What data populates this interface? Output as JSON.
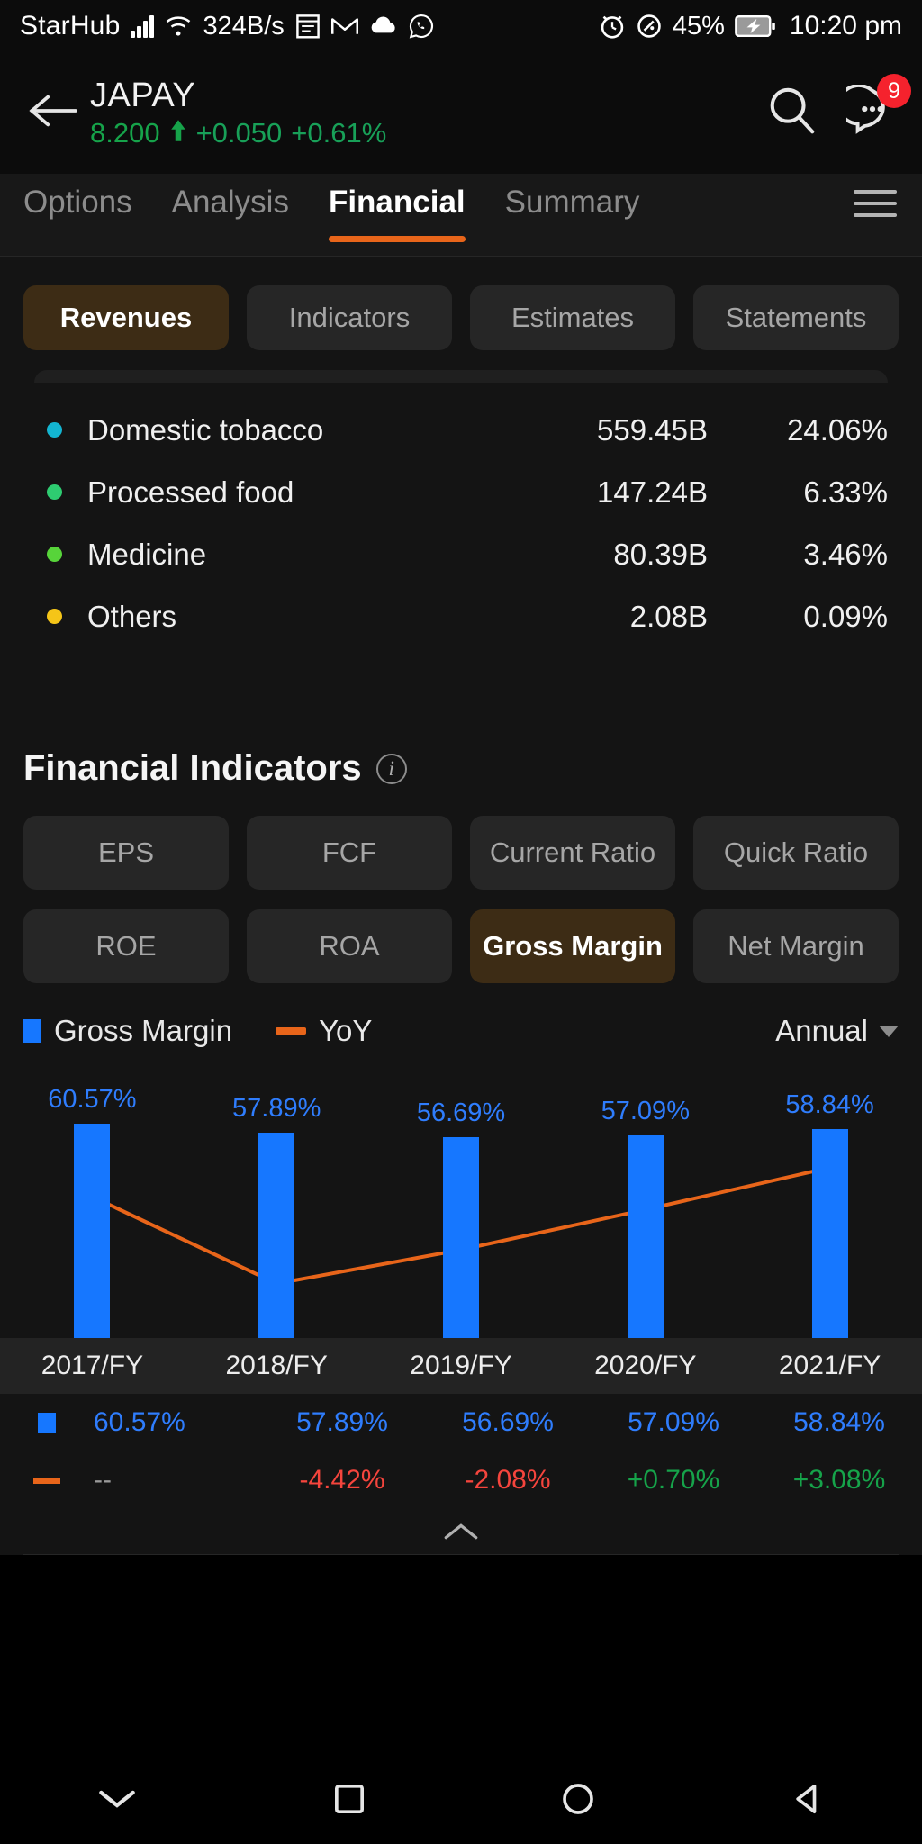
{
  "statusbar": {
    "carrier": "StarHub",
    "icons_left": [
      "signal-bars-icon",
      "wifi-icon"
    ],
    "data_rate": "324B/s",
    "icons_mid": [
      "calendar-icon",
      "gmail-icon",
      "cloud-icon",
      "whatsapp-icon"
    ],
    "icons_right": [
      "alarm-icon",
      "dnd-icon"
    ],
    "battery_percent": "45%",
    "battery_icon": "battery-charging-icon",
    "time": "10:20 pm"
  },
  "header": {
    "back_icon": "back-arrow-icon",
    "symbol": "JAPAY",
    "price": "8.200",
    "arrow": "↑",
    "change": "+0.050",
    "change_pct": "+0.61%",
    "up_color": "#16a34a",
    "search_icon": "search-icon",
    "chat_icon": "chat-more-icon",
    "badge_count": "9"
  },
  "tabs": {
    "items": [
      {
        "label": "Options",
        "active": false
      },
      {
        "label": "Analysis",
        "active": false
      },
      {
        "label": "Financial",
        "active": true
      },
      {
        "label": "Summary",
        "active": false
      }
    ],
    "menu_icon": "hamburger-menu-icon",
    "active_underline_color": "#e8651a"
  },
  "subtabs": {
    "items": [
      {
        "label": "Revenues",
        "active": true
      },
      {
        "label": "Indicators",
        "active": false
      },
      {
        "label": "Estimates",
        "active": false
      },
      {
        "label": "Statements",
        "active": false
      }
    ]
  },
  "revenues": {
    "rows": [
      {
        "name": "Domestic tobacco",
        "value": "559.45B",
        "pct": "24.06%",
        "color": "#13b5d1"
      },
      {
        "name": "Processed food",
        "value": "147.24B",
        "pct": "6.33%",
        "color": "#2ecc71"
      },
      {
        "name": "Medicine",
        "value": "80.39B",
        "pct": "3.46%",
        "color": "#57d43a"
      },
      {
        "name": "Others",
        "value": "2.08B",
        "pct": "0.09%",
        "color": "#f5c518"
      }
    ]
  },
  "financial_indicators": {
    "title": "Financial Indicators",
    "info_icon": "info-icon",
    "info_glyph": "i",
    "buttons": [
      {
        "label": "EPS",
        "active": false
      },
      {
        "label": "FCF",
        "active": false
      },
      {
        "label": "Current Ratio",
        "active": false
      },
      {
        "label": "Quick Ratio",
        "active": false
      },
      {
        "label": "ROE",
        "active": false
      },
      {
        "label": "ROA",
        "active": false
      },
      {
        "label": "Gross Margin",
        "active": true
      },
      {
        "label": "Net Margin",
        "active": false
      }
    ],
    "legend": [
      {
        "label": "Gross Margin",
        "marker": "square",
        "color": "#1677ff"
      },
      {
        "label": "YoY",
        "marker": "line",
        "color": "#e8651a"
      }
    ],
    "period": {
      "label": "Annual",
      "caret_icon": "chevron-down-icon"
    },
    "collapse_icon": "chevron-up-icon",
    "collapse_glyph": "⌃"
  },
  "chart_data": {
    "type": "bar",
    "title": "Gross Margin",
    "categories": [
      "2017/FY",
      "2018/FY",
      "2019/FY",
      "2020/FY",
      "2021/FY"
    ],
    "series": [
      {
        "name": "Gross Margin",
        "type": "bar",
        "color": "#1677ff",
        "values": [
          60.57,
          57.89,
          56.69,
          57.09,
          58.84
        ],
        "labels": [
          "60.57%",
          "57.89%",
          "56.69%",
          "57.09%",
          "58.84%"
        ]
      },
      {
        "name": "YoY",
        "type": "line",
        "color": "#e8651a",
        "values": [
          null,
          -4.42,
          -2.08,
          0.7,
          3.08
        ],
        "labels": [
          "--",
          "-4.42%",
          "-2.08%",
          "+0.70%",
          "+3.08%"
        ],
        "label_colors": [
          "#9a9a9a",
          "#f5453d",
          "#f5453d",
          "#16a34a",
          "#16a34a"
        ],
        "point_plot_values": [
          1.6,
          -4.42,
          -2.08,
          0.7,
          3.6
        ]
      }
    ],
    "ylim": [
      0,
      62
    ],
    "yoy_ylim": [
      -6,
      4.4
    ],
    "xlabel": "",
    "ylabel": "",
    "grid": false,
    "legend_position": "top-left"
  },
  "navbar": {
    "items": [
      {
        "icon": "chevron-down-icon",
        "glyph": "⌄"
      },
      {
        "icon": "square-recents-icon",
        "glyph": "□"
      },
      {
        "icon": "circle-home-icon",
        "glyph": "○"
      },
      {
        "icon": "triangle-back-icon",
        "glyph": "◁"
      }
    ]
  }
}
